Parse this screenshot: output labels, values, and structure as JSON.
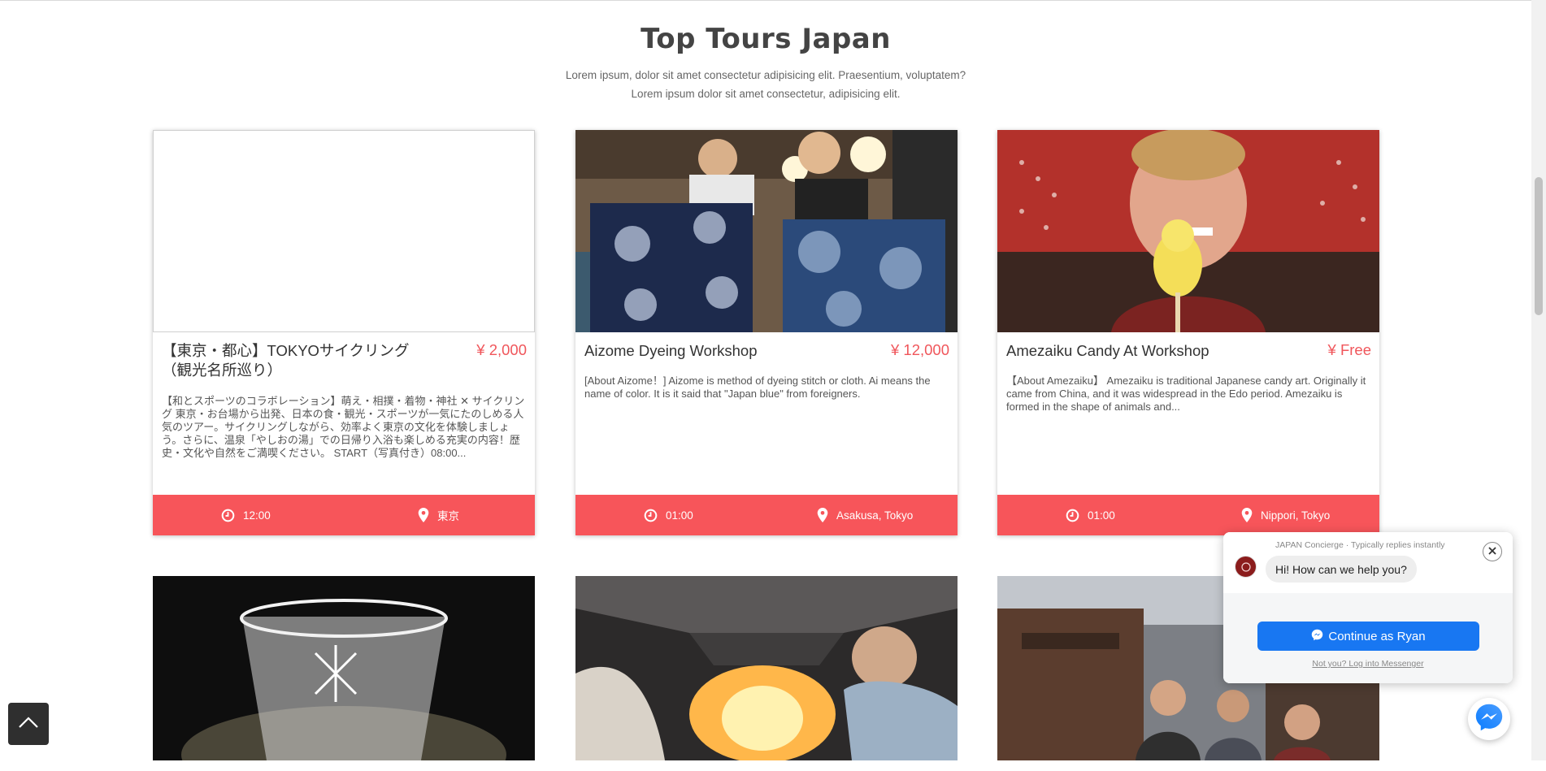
{
  "section": {
    "title": "Top Tours Japan",
    "subtitle_line1": "Lorem ipsum, dolor sit amet consectetur adipisicing elit. Praesentium, voluptatem?",
    "subtitle_line2": "Lorem ipsum dolor sit amet consectetur, adipisicing elit."
  },
  "tours": [
    {
      "title": "【東京・都心】TOKYOサイクリング（観光名所巡り）",
      "price": "¥ 2,000",
      "description": "【和とスポーツのコラボレーション】萌え・相撲・着物・神社 ✕ サイクリング 東京・お台場から出発、日本の食・観光・スポーツが一気にたのしめる人気のツアー。サイクリングしながら、効率よく東京の文化を体験しましょう。さらに、温泉「やしおの湯」での日帰り入浴も楽しめる充実の内容！歴史・文化や自然をご満喫ください。 START（写真付き）08:00...",
      "time": "12:00",
      "location": "東京",
      "image": "blank"
    },
    {
      "title": "Aizome Dyeing Workshop",
      "price": "¥ 12,000",
      "description": "[About Aizome！] Aizome is method of dyeing stitch or cloth. Ai means the name of color. It is it said that \"Japan blue\" from foreigners.",
      "time": "01:00",
      "location": "Asakusa, Tokyo",
      "image": "indigo-dyed-cloth-photo"
    },
    {
      "title": "Amezaiku Candy At Workshop",
      "price": "¥ Free",
      "description": "【About Amezaiku】 Amezaiku is traditional Japanese candy art. Originally it came from China, and it was widespread in the Edo period. Amezaiku is formed in the shape of animals and...",
      "time": "01:00",
      "location": "Nippori, Tokyo",
      "image": "candy-art-photo"
    }
  ],
  "lower_tours": [
    {
      "image": "cut-glass-photo"
    },
    {
      "image": "blacksmith-forge-photo"
    },
    {
      "image": "old-street-people-photo"
    }
  ],
  "messenger": {
    "page_name": "JAPAN Concierge · Typically replies instantly",
    "greeting": "Hi! How can we help you?",
    "continue_label": "Continue as Ryan",
    "not_you": "Not you? Log into Messenger"
  },
  "colors": {
    "accent": "#f7555a",
    "price": "#f0565b",
    "messenger_blue": "#1877f2"
  },
  "icons": [
    "clock-icon",
    "map-pin-icon",
    "chevron-up-icon",
    "close-icon",
    "messenger-icon"
  ]
}
